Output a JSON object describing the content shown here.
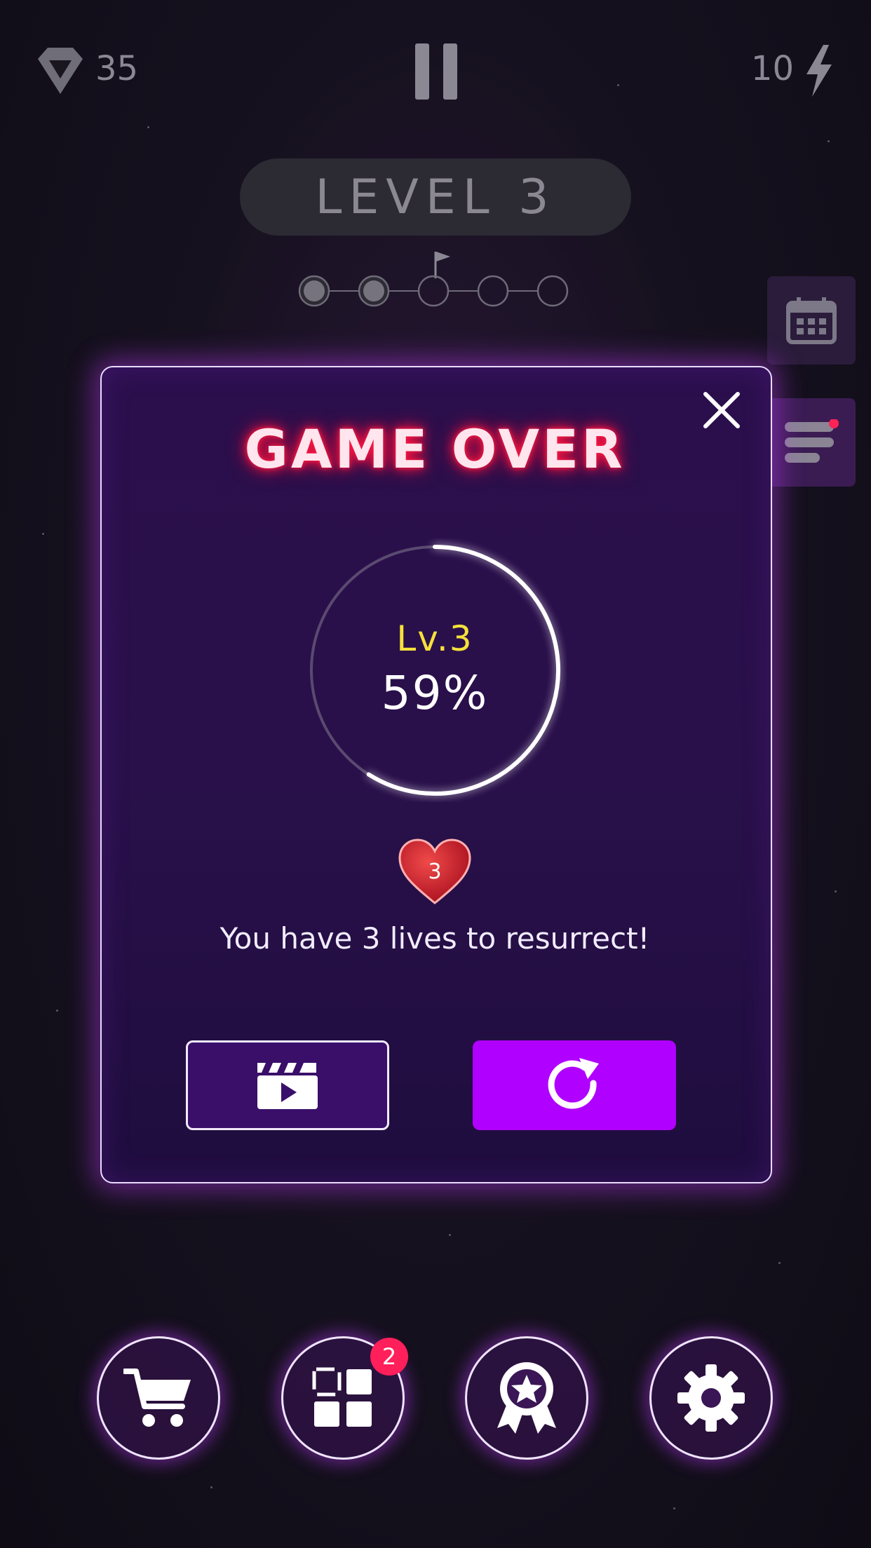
{
  "hud": {
    "gems": "35",
    "gem_icon": "diamond-icon",
    "energy": "10",
    "energy_icon": "lightning-bolt-icon",
    "pause_icon": "pause-icon"
  },
  "level": {
    "title": "LEVEL 3",
    "stages_total": 5,
    "stages_completed": 2,
    "flag_icon": "flag-icon"
  },
  "side_buttons": [
    {
      "icon": "calendar-icon"
    },
    {
      "icon": "task-list-icon"
    }
  ],
  "modal": {
    "title": "GAME OVER",
    "progress_level": "Lv.3",
    "progress_percent": "59%",
    "progress_value": 0.59,
    "lives": "3",
    "message": "You have 3 lives to resurrect!",
    "watch_video_icon": "video-clapperboard-play-icon",
    "retry_icon": "restart-arrow-icon",
    "close_icon": "close-icon"
  },
  "bottom_nav": {
    "shop_icon": "shopping-cart-icon",
    "levels_icon": "grid-blocks-icon",
    "levels_badge": "2",
    "awards_icon": "award-ribbon-icon",
    "settings_icon": "gear-icon"
  },
  "colors": {
    "title_glow": "#ff1a44",
    "level_text": "#f5e13a",
    "retry_button": "#b000ff",
    "badge": "#ff1f5a"
  }
}
